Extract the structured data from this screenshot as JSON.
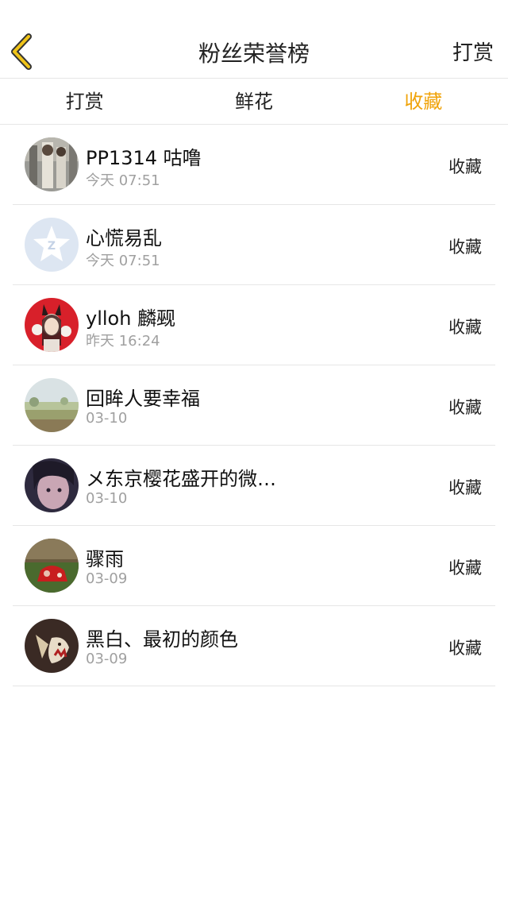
{
  "nav": {
    "title": "粉丝荣誉榜",
    "right_label": "打赏",
    "back_icon": "chevron-left-icon",
    "accent": "#f0c419"
  },
  "tabs": [
    {
      "label": "打赏",
      "active": false
    },
    {
      "label": "鲜花",
      "active": false
    },
    {
      "label": "收藏",
      "active": true
    }
  ],
  "colors": {
    "active_tab": "#f0a30a",
    "time_text": "#a0a0a0",
    "divider": "#e6e6e6"
  },
  "list": [
    {
      "name": "PP1314 咕噜",
      "time": "今天 07:51",
      "action": "收藏"
    },
    {
      "name": "心慌易乱",
      "time": "今天 07:51",
      "action": "收藏"
    },
    {
      "name": "ylloh 麟觋",
      "time": "昨天 16:24",
      "action": "收藏"
    },
    {
      "name": "回眸人要幸福",
      "time": "03-10",
      "action": "收藏"
    },
    {
      "name": "メ东京樱花盛开的微…",
      "time": "03-10",
      "action": "收藏"
    },
    {
      "name": "骤雨",
      "time": "03-09",
      "action": "收藏"
    },
    {
      "name": "黑白、最初的颜色",
      "time": "03-09",
      "action": "收藏"
    }
  ]
}
